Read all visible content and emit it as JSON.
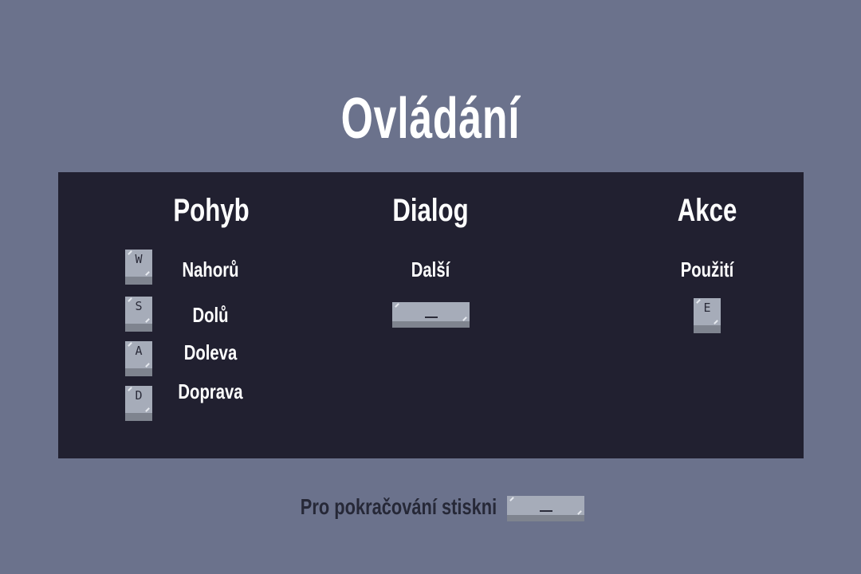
{
  "title": "Ovládání",
  "columns": {
    "move": {
      "title": "Pohyb",
      "items": [
        {
          "key": "W",
          "label": "Nahorů"
        },
        {
          "key": "S",
          "label": "Dolů"
        },
        {
          "key": "A",
          "label": "Doleva"
        },
        {
          "key": "D",
          "label": "Doprava"
        }
      ]
    },
    "dialog": {
      "title": "Dialog",
      "items": [
        {
          "key": "space",
          "label": "Další"
        }
      ]
    },
    "action": {
      "title": "Akce",
      "items": [
        {
          "key": "E",
          "label": "Použití"
        }
      ]
    }
  },
  "footer": {
    "text": "Pro pokračování stiskni",
    "key": "space"
  },
  "colors": {
    "background": "#6b728c",
    "panel": "#212030",
    "key": "#a6acb9",
    "key_shadow": "#7f848f",
    "text": "#ffffff",
    "footer_text": "#262837"
  }
}
